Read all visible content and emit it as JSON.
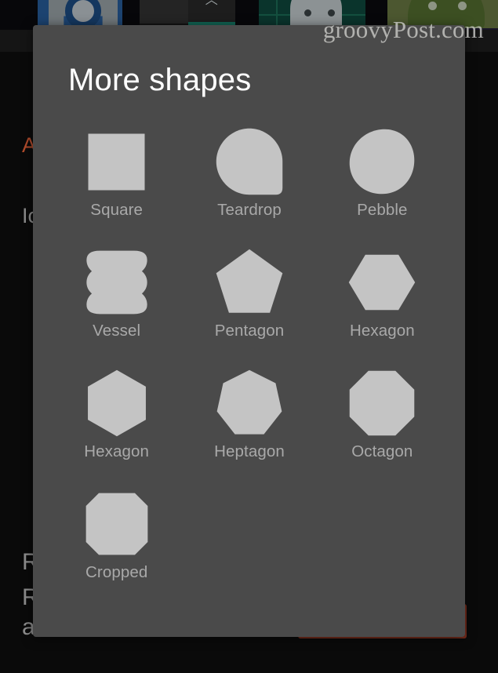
{
  "watermark": "groovyPost.com",
  "background": {
    "app_icons": [
      {
        "name": "blue-ring-icon",
        "color": "#1c4370"
      },
      {
        "name": "dark-teal-icon",
        "color": "#1d1d1d"
      },
      {
        "name": "teal-grid-android-icon",
        "color": "#0a342c"
      },
      {
        "name": "olive-android-icon",
        "color": "#4c5730"
      }
    ],
    "accent_color": "#b14b2c",
    "lines": {
      "title_fragment": "A",
      "sub_fragment": "Ic",
      "row1_fragment": "R",
      "row2_fragment": "R",
      "row3": "all icons match"
    }
  },
  "dialog": {
    "title": "More shapes",
    "shapes": [
      {
        "label": "Square",
        "icon": "square-shape-icon"
      },
      {
        "label": "Teardrop",
        "icon": "teardrop-shape-icon"
      },
      {
        "label": "Pebble",
        "icon": "pebble-shape-icon"
      },
      {
        "label": "Vessel",
        "icon": "vessel-shape-icon"
      },
      {
        "label": "Pentagon",
        "icon": "pentagon-shape-icon"
      },
      {
        "label": "Hexagon",
        "icon": "hexagon-flat-shape-icon"
      },
      {
        "label": "Hexagon",
        "icon": "hexagon-pointy-shape-icon"
      },
      {
        "label": "Heptagon",
        "icon": "heptagon-shape-icon"
      },
      {
        "label": "Octagon",
        "icon": "octagon-shape-icon"
      },
      {
        "label": "Cropped",
        "icon": "cropped-square-shape-icon"
      }
    ],
    "colors": {
      "surface": "#4a4a4a",
      "shape_fill": "#c4c4c4",
      "label": "#a9a9a9",
      "title": "#ffffff"
    }
  }
}
